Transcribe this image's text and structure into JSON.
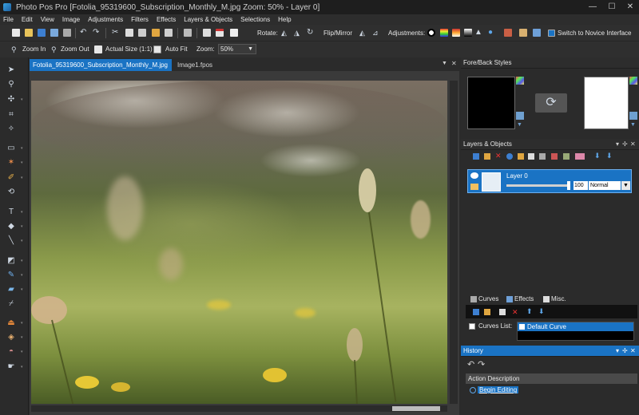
{
  "app": {
    "title": "Photo Pos Pro [Fotolia_95319600_Subscription_Monthly_M.jpg Zoom: 50% - Layer 0]"
  },
  "menu": [
    "File",
    "Edit",
    "View",
    "Image",
    "Adjustments",
    "Filters",
    "Effects",
    "Layers & Objects",
    "Selections",
    "Help"
  ],
  "toolbar": {
    "rotate_label": "Rotate:",
    "flip_label": "Flip/Mirror",
    "adjustments_label": "Adjustments:",
    "novice_label": "Switch to Novice Interface"
  },
  "view_toolbar": {
    "zoom_in": "Zoom In",
    "zoom_out": "Zoom Out",
    "actual_size": "Actual Size (1:1)",
    "auto_fit": "Auto Fit",
    "zoom_label": "Zoom:",
    "zoom_value": "50%"
  },
  "documents": {
    "active_tab": "Fotolia_95319600_Subscription_Monthly_M.jpg",
    "inactive_tab": "Image1.fpos"
  },
  "panels": {
    "fore_back": {
      "title": "Fore/Back Styles",
      "fore_color": "#000000",
      "back_color": "#ffffff"
    },
    "layers": {
      "title": "Layers & Objects",
      "layer_name": "Layer 0",
      "opacity": "100",
      "blend_mode": "Normal",
      "sub_tabs": [
        "Curves",
        "Effects",
        "Misc."
      ],
      "curves_list_label": "Curves List:",
      "curve_item": "Default Curve"
    },
    "history": {
      "title": "History",
      "column_header": "Action Description",
      "items": [
        "Begin Editing"
      ]
    }
  },
  "colors": {
    "accent": "#1a73c4",
    "background": "#2b2b2b"
  }
}
